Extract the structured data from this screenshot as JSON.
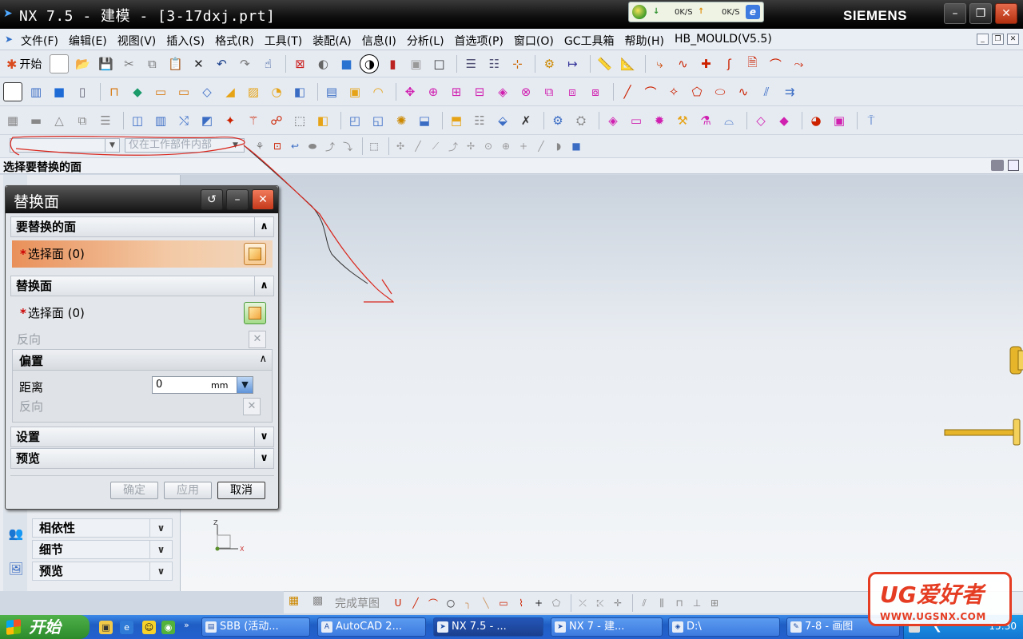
{
  "window": {
    "title": "NX 7.5 - 建模 - [3-17dxj.prt]",
    "brand": "SIEMENS",
    "controls": [
      "minimize",
      "restore",
      "close"
    ]
  },
  "netmon": {
    "down_label": "0K/S",
    "up_label": "0K/S"
  },
  "menubar": {
    "items": [
      "文件(F)",
      "编辑(E)",
      "视图(V)",
      "插入(S)",
      "格式(R)",
      "工具(T)",
      "装配(A)",
      "信息(I)",
      "分析(L)",
      "首选项(P)",
      "窗口(O)",
      "GC工具箱",
      "帮助(H)",
      "HB_MOULD(V5.5)"
    ]
  },
  "toolbar": {
    "start_label": "开始",
    "filter_value": "",
    "scope_value": "仅在工作部件内部"
  },
  "status": {
    "prompt": "选择要替换的面"
  },
  "dialog": {
    "title": "替换面",
    "sections": {
      "faces_to_replace": "要替换的面",
      "replacement_face": "替换面",
      "offset": "偏置",
      "settings": "设置",
      "preview": "预览"
    },
    "select_face_1": "选择面 (0)",
    "select_face_2": "选择面 (0)",
    "reverse_1": "反向",
    "reverse_2": "反向",
    "distance_label": "距离",
    "distance_value": "0",
    "distance_unit": "mm",
    "buttons": {
      "ok": "确定",
      "apply": "应用",
      "cancel": "取消"
    }
  },
  "resource_panels": [
    "相依性",
    "细节",
    "预览"
  ],
  "sketch_toolbar": {
    "done_label": "完成草图"
  },
  "taskbar": {
    "start_label": "开始",
    "tasks": [
      "SBB (活动...",
      "AutoCAD 2...",
      "NX 7.5 - ...",
      "NX 7 - 建...",
      "D:\\",
      "7-8 - 画图"
    ],
    "clock": "15:30"
  },
  "watermark": {
    "text": "UG爱好者",
    "url": "WWW.UGSNX.COM"
  },
  "colors": {
    "accent": "#e53d23",
    "selection_active": "#e9905a",
    "titlebar": "#111111"
  }
}
